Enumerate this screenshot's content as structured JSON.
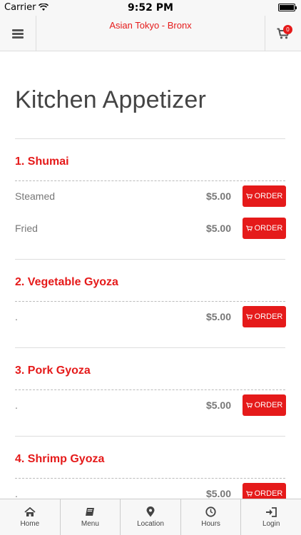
{
  "status_bar": {
    "carrier": "Carrier",
    "time": "9:52 PM",
    "battery_level": 1.0
  },
  "header": {
    "title": "Asian Tokyo - Bronx",
    "cart_count": "0"
  },
  "page": {
    "title": "Kitchen Appetizer"
  },
  "order_label": "ORDER",
  "items": [
    {
      "name": "1. Shumai",
      "options": [
        {
          "label": "Steamed",
          "price": "$5.00"
        },
        {
          "label": "Fried",
          "price": "$5.00"
        }
      ]
    },
    {
      "name": "2. Vegetable Gyoza",
      "options": [
        {
          "label": ".",
          "price": "$5.00"
        }
      ]
    },
    {
      "name": "3. Pork Gyoza",
      "options": [
        {
          "label": ".",
          "price": "$5.00"
        }
      ]
    },
    {
      "name": "4. Shrimp Gyoza",
      "options": [
        {
          "label": ".",
          "price": "$5.00"
        }
      ]
    }
  ],
  "tabs": [
    {
      "label": "Home",
      "icon": "home-icon"
    },
    {
      "label": "Menu",
      "icon": "book-icon"
    },
    {
      "label": "Location",
      "icon": "map-pin-icon"
    },
    {
      "label": "Hours",
      "icon": "clock-icon"
    },
    {
      "label": "Login",
      "icon": "login-icon"
    }
  ],
  "colors": {
    "accent": "#e51a1a",
    "bar_bg": "#f7f7f7"
  }
}
